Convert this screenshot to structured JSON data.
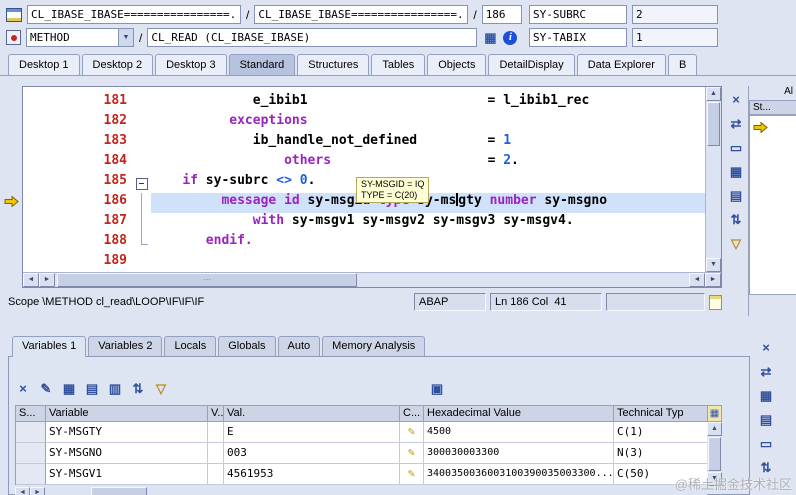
{
  "topbar": {
    "row1": {
      "program": "CL_IBASE_IBASE================...",
      "slash": "/",
      "include": "CL_IBASE_IBASE================...",
      "line": "186",
      "watch_name": "SY-SUBRC",
      "watch_value": "2"
    },
    "row2": {
      "event": "METHOD",
      "slash": "/",
      "event_detail": "CL_READ (CL_IBASE_IBASE)",
      "combo_arrow": "▼",
      "grid_glyph": "▦",
      "info_glyph": "i",
      "watch_name": "SY-TABIX",
      "watch_value": "1"
    }
  },
  "desktop_tabs": {
    "active_index": 3,
    "items": [
      "Desktop 1",
      "Desktop 2",
      "Desktop 3",
      "Standard",
      "Structures",
      "Tables",
      "Objects",
      "DetailDisplay",
      "Data Explorer",
      "B"
    ]
  },
  "editor": {
    "tooltip_line1": "SY-MSGID = IQ",
    "tooltip_line2": "TYPE = C(20)",
    "lines": [
      {
        "num": "181",
        "fold": "",
        "current": false,
        "segments": [
          {
            "c": "id",
            "t": "             e_ibib1"
          },
          {
            "c": "id",
            "t": "                       = l_ibib1_rec"
          }
        ]
      },
      {
        "num": "182",
        "fold": "",
        "current": false,
        "segments": [
          {
            "c": "id",
            "t": "          "
          },
          {
            "c": "kw",
            "t": "exceptions"
          }
        ]
      },
      {
        "num": "183",
        "fold": "",
        "current": false,
        "segments": [
          {
            "c": "id",
            "t": "             ib_handle_not_defined"
          },
          {
            "c": "id",
            "t": "         = "
          },
          {
            "c": "num",
            "t": "1"
          }
        ]
      },
      {
        "num": "184",
        "fold": "",
        "current": false,
        "segments": [
          {
            "c": "id",
            "t": "                 "
          },
          {
            "c": "kw",
            "t": "others"
          },
          {
            "c": "id",
            "t": "                    = "
          },
          {
            "c": "num",
            "t": "2"
          },
          {
            "c": "id",
            "t": "."
          }
        ]
      },
      {
        "num": "185",
        "fold": "start",
        "current": false,
        "segments": [
          {
            "c": "id",
            "t": "    "
          },
          {
            "c": "kw",
            "t": "if"
          },
          {
            "c": "id",
            "t": " sy-subrc "
          },
          {
            "c": "op",
            "t": "<>"
          },
          {
            "c": "id",
            "t": " "
          },
          {
            "c": "num",
            "t": "0"
          },
          {
            "c": "id",
            "t": "."
          }
        ]
      },
      {
        "num": "186",
        "fold": "mid",
        "current": true,
        "segments": [
          {
            "c": "id",
            "t": "         "
          },
          {
            "c": "kw",
            "t": "message"
          },
          {
            "c": "id",
            "t": " "
          },
          {
            "c": "kw",
            "t": "id"
          },
          {
            "c": "id",
            "t": " sy-msgid "
          },
          {
            "c": "kw",
            "t": "type"
          },
          {
            "c": "id",
            "t": " sy-ms"
          },
          {
            "c": "caret",
            "t": ""
          },
          {
            "c": "id",
            "t": "gty "
          },
          {
            "c": "kw",
            "t": "number"
          },
          {
            "c": "id",
            "t": " sy-msgno"
          }
        ]
      },
      {
        "num": "187",
        "fold": "mid",
        "current": false,
        "segments": [
          {
            "c": "id",
            "t": "             "
          },
          {
            "c": "kw",
            "t": "with"
          },
          {
            "c": "id",
            "t": " sy-msgv1 sy-msgv2 sy-msgv3 sy-msgv4."
          }
        ]
      },
      {
        "num": "188",
        "fold": "end",
        "current": false,
        "segments": [
          {
            "c": "id",
            "t": "       "
          },
          {
            "c": "kw",
            "t": "endif."
          }
        ]
      },
      {
        "num": "189",
        "fold": "",
        "current": false,
        "segments": []
      }
    ]
  },
  "statusbar": {
    "scope": "Scope \\METHOD cl_read\\LOOP\\IF\\IF\\IF",
    "language": "ABAP",
    "position": "Ln 186 Col  41"
  },
  "right_panel": {
    "header": "Al",
    "column": "St..."
  },
  "editor_side_icons": [
    {
      "name": "close-tool-icon",
      "glyph": "×"
    },
    {
      "name": "swap-tool-icon",
      "glyph": "⇄"
    },
    {
      "name": "maximize-tool-icon",
      "glyph": "▭"
    },
    {
      "name": "new-tool-icon",
      "glyph": "▦"
    },
    {
      "name": "layout-icon",
      "glyph": "▤"
    },
    {
      "name": "scroll-sync-icon",
      "glyph": "⇅"
    },
    {
      "name": "tool-services-icon",
      "glyph": "▽",
      "color": "#b98e1a"
    }
  ],
  "panel_side_icons": [
    {
      "name": "close-tool-icon",
      "glyph": "×"
    },
    {
      "name": "swap-tool-icon",
      "glyph": "⇄"
    },
    {
      "name": "table-view-icon",
      "glyph": "▦"
    },
    {
      "name": "layout-icon",
      "glyph": "▤"
    },
    {
      "name": "maximize-tool-icon",
      "glyph": "▭"
    },
    {
      "name": "scroll-sync-icon",
      "glyph": "⇅"
    }
  ],
  "variables_tabs": {
    "active_index": 0,
    "items": [
      "Variables 1",
      "Variables 2",
      "Locals",
      "Globals",
      "Auto",
      "Memory Analysis"
    ]
  },
  "variables_toolbar": [
    {
      "name": "delete-variable-icon",
      "glyph": "×"
    },
    {
      "name": "change-variable-icon",
      "glyph": "✎"
    },
    {
      "name": "append-row-icon",
      "glyph": "▦"
    },
    {
      "name": "insert-row-icon",
      "glyph": "▤"
    },
    {
      "name": "columns-icon",
      "glyph": "▥"
    },
    {
      "name": "sort-icon",
      "glyph": "⇅"
    },
    {
      "name": "filter-icon",
      "glyph": "▽",
      "color": "#b98e1a"
    }
  ],
  "save_icon": {
    "name": "save-layout-icon",
    "glyph": "▣"
  },
  "variables_table": {
    "columns": [
      "S...",
      "Variable",
      "V...",
      "Val.",
      "C...",
      "Hexadecimal Value",
      "Technical Typ"
    ],
    "corner_glyph": "▦",
    "edit_glyph": "✎",
    "rows": [
      {
        "variable": "SY-MSGTY",
        "val": "E",
        "hex": "4500",
        "type": "C(1)"
      },
      {
        "variable": "SY-MSGNO",
        "val": "003",
        "hex": "300030003300",
        "type": "N(3)"
      },
      {
        "variable": "SY-MSGV1",
        "val": "4561953",
        "hex": "3400350036003100390035003300...",
        "type": "C(50)"
      }
    ]
  },
  "scroll_glyphs": {
    "up": "▲",
    "down": "▼",
    "left": "◄",
    "right": "►"
  },
  "watermark": "@稀土掘金技术社区",
  "colors": {
    "keyword": "#9a23c0",
    "literal": "#1a5fe0",
    "line_number": "#c2251c",
    "current_line": "#cfe2fa",
    "exec_arrow": "#f5c400"
  }
}
